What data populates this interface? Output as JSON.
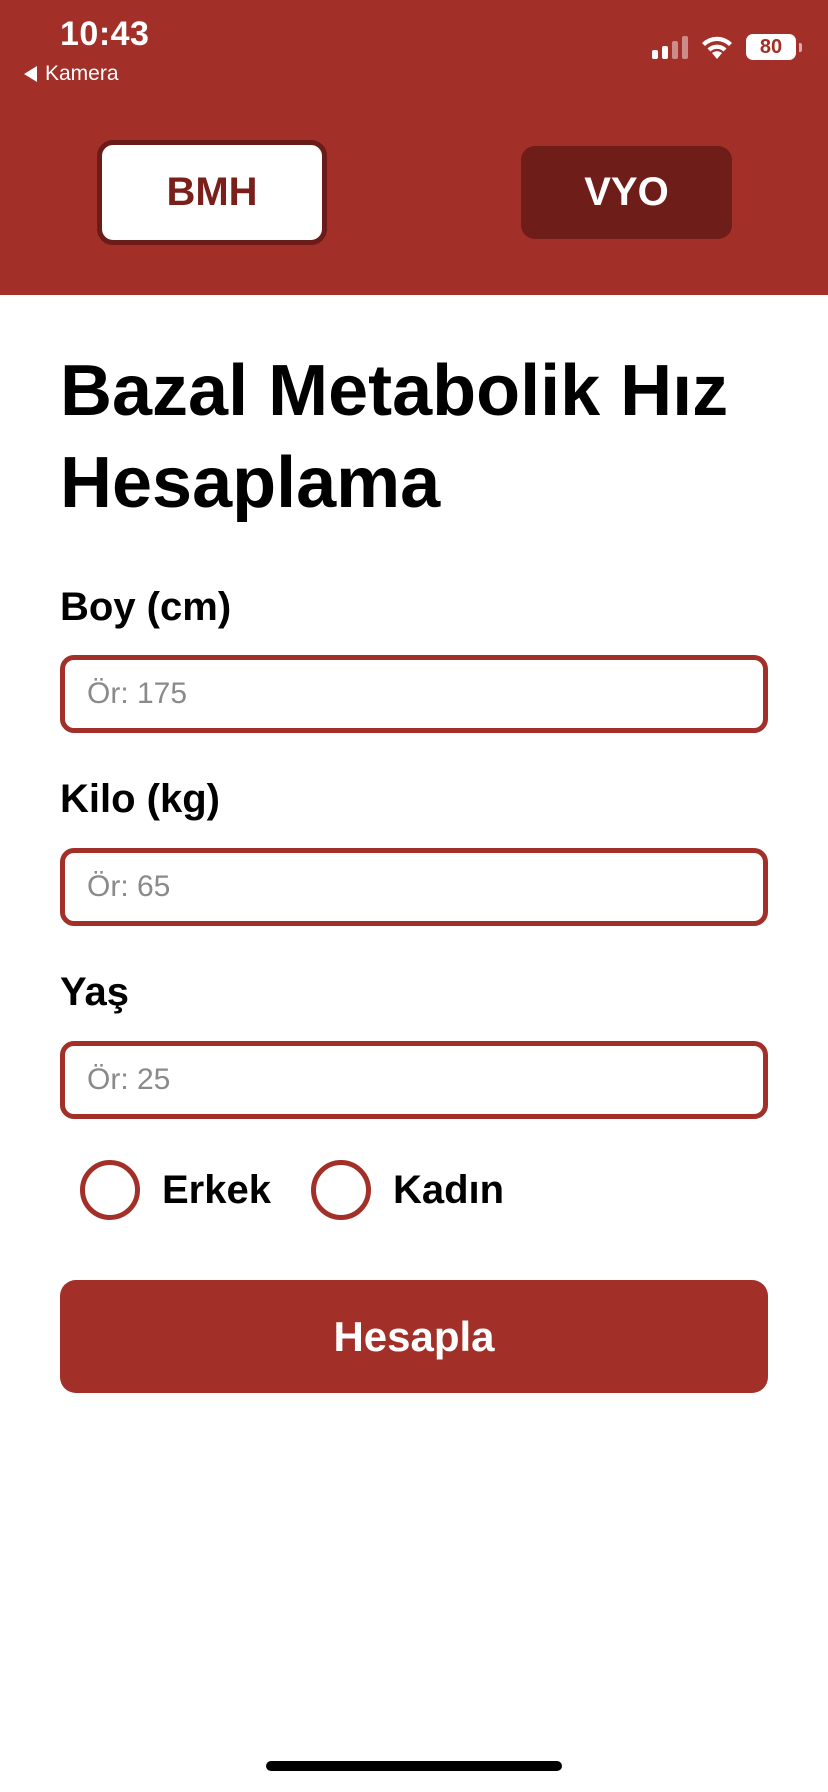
{
  "status_bar": {
    "time": "10:43",
    "back_app": "Kamera",
    "battery": "80",
    "icons": [
      "cellular-signal-icon",
      "wifi-icon",
      "battery-icon",
      "back-arrow-icon"
    ]
  },
  "tabs": [
    {
      "label": "BMH",
      "selected": true
    },
    {
      "label": "VYO",
      "selected": false
    }
  ],
  "page": {
    "title": "Bazal Metabolik Hız Hesaplama"
  },
  "form": {
    "height": {
      "label": "Boy (cm)",
      "placeholder": "Ör: 175",
      "value": ""
    },
    "weight": {
      "label": "Kilo (kg)",
      "placeholder": "Ör: 65",
      "value": ""
    },
    "age": {
      "label": "Yaş",
      "placeholder": "Ör: 25",
      "value": ""
    },
    "gender_options": [
      {
        "label": "Erkek",
        "selected": false
      },
      {
        "label": "Kadın",
        "selected": false
      }
    ],
    "submit_label": "Hesapla"
  },
  "colors": {
    "primary": "#a22f28",
    "primary_dark": "#6e1d19",
    "background": "#ffffff",
    "text": "#000000",
    "placeholder": "#8a8a8a"
  }
}
